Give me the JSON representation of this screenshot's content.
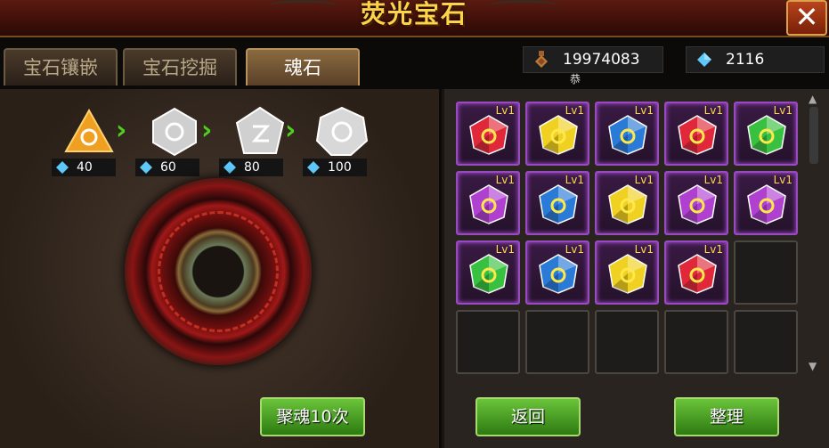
{
  "header": {
    "title": "荧光宝石"
  },
  "tabs": [
    {
      "label": "宝石镶嵌"
    },
    {
      "label": "宝石挖掘"
    },
    {
      "label": "魂石"
    }
  ],
  "resources": {
    "gold": {
      "value": "19974083",
      "sub": "恭"
    },
    "diamond": {
      "value": "2116"
    }
  },
  "stages": [
    {
      "gem_color": "orange",
      "cost": "40"
    },
    {
      "gem_color": "white",
      "cost": "60"
    },
    {
      "gem_color": "white",
      "cost": "80"
    },
    {
      "gem_color": "white",
      "cost": "100"
    }
  ],
  "buttons": {
    "gather_10": "聚魂10次",
    "back": "返回",
    "sort": "整理"
  },
  "inventory": [
    {
      "color": "red",
      "level": "Lv1"
    },
    {
      "color": "yellow",
      "level": "Lv1"
    },
    {
      "color": "blue",
      "level": "Lv1"
    },
    {
      "color": "red",
      "level": "Lv1"
    },
    {
      "color": "green",
      "level": "Lv1"
    },
    {
      "color": "purple",
      "level": "Lv1"
    },
    {
      "color": "blue",
      "level": "Lv1"
    },
    {
      "color": "yellow",
      "level": "Lv1"
    },
    {
      "color": "purple",
      "level": "Lv1"
    },
    {
      "color": "purple",
      "level": "Lv1"
    },
    {
      "color": "green",
      "level": "Lv1"
    },
    {
      "color": "blue",
      "level": "Lv1"
    },
    {
      "color": "yellow",
      "level": "Lv1"
    },
    {
      "color": "red",
      "level": "Lv1"
    },
    {
      "color": null,
      "level": null
    },
    {
      "color": null,
      "level": null
    },
    {
      "color": null,
      "level": null
    },
    {
      "color": null,
      "level": null
    },
    {
      "color": null,
      "level": null
    },
    {
      "color": null,
      "level": null
    }
  ],
  "colors": {
    "red": "#e0283a",
    "yellow": "#f0d020",
    "blue": "#2a7ad8",
    "green": "#38c040",
    "purple": "#b040d0",
    "orange": "#f0a020",
    "white": "#d8d8d8"
  }
}
